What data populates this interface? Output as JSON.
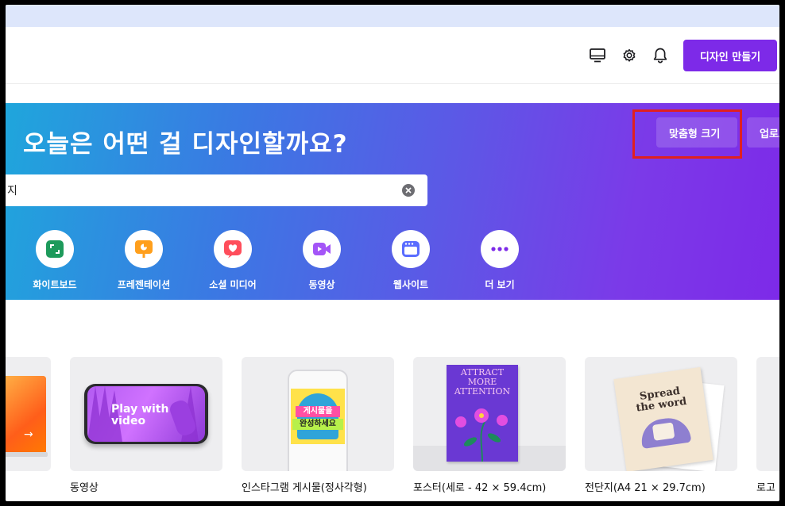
{
  "header": {
    "create_label": "디자인 만들기",
    "icons": [
      "desktop-icon",
      "gear-icon",
      "bell-icon"
    ]
  },
  "hero": {
    "title": "오늘은 어떤 걸 디자인할까요?",
    "custom_size_label": "맞춤형 크기",
    "upload_label": "업로드",
    "search_value": "지"
  },
  "categories": [
    {
      "label": "화이트보드",
      "icon": "whiteboard-icon",
      "color": "#1d9a5b"
    },
    {
      "label": "프레젠테이션",
      "icon": "presentation-icon",
      "color": "#ff9f1c"
    },
    {
      "label": "소셜 미디어",
      "icon": "heart-icon",
      "color": "#ff4d5b"
    },
    {
      "label": "동영상",
      "icon": "video-icon",
      "color": "#a455f7"
    },
    {
      "label": "웹사이트",
      "icon": "website-icon",
      "color": "#5a6dff"
    },
    {
      "label": "더 보기",
      "icon": "more-icon",
      "color": "#7d2ae8"
    }
  ],
  "templates": [
    {
      "label": ""
    },
    {
      "label": "동영상",
      "thumb_text": "Play with video"
    },
    {
      "label": "인스타그램 게시물(정사각형)",
      "thumb_text_1": "게시물을",
      "thumb_text_2": "완성하세요"
    },
    {
      "label": "포스터(세로 - 42 × 59.4cm)",
      "thumb_text": "ATTRACT MORE ATTENTION"
    },
    {
      "label": "전단지(A4 21 × 29.7cm)",
      "thumb_text_1": "Spread",
      "thumb_text_2": "the word"
    },
    {
      "label": "로고"
    }
  ]
}
